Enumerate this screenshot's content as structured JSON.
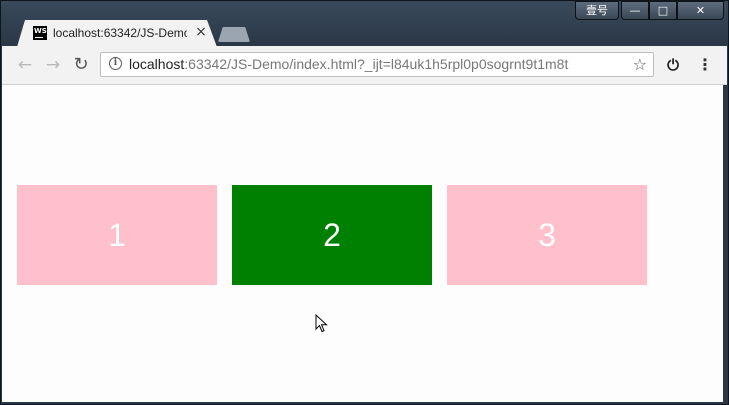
{
  "tab": {
    "favicon_text": "WS",
    "title": "localhost:63342/JS-Demo",
    "close_glyph": "×"
  },
  "window_controls": {
    "user_label": "壹号",
    "min_glyph": "—",
    "max_glyph": "□",
    "close_glyph": "✕"
  },
  "toolbar": {
    "back_glyph": "←",
    "forward_glyph": "→",
    "reload_glyph": "↻",
    "url_host": "localhost",
    "url_rest": ":63342/JS-Demo/index.html?_ijt=l84uk1h5rpl0p0sogrnt9t1m8t",
    "star_glyph": "☆",
    "power_glyph": "⏻",
    "menu_glyph": "⋮"
  },
  "boxes": [
    {
      "label": "1",
      "color": "#ffc0cb",
      "active": false
    },
    {
      "label": "2",
      "color": "#008000",
      "active": true
    },
    {
      "label": "3",
      "color": "#ffc0cb",
      "active": false
    }
  ],
  "icons": {
    "favicon": "webstorm-icon",
    "info": "info-icon",
    "star": "bookmark-star-icon",
    "power": "power-icon",
    "menu": "kebab-menu-icon",
    "cursor": "mouse-cursor-icon"
  }
}
